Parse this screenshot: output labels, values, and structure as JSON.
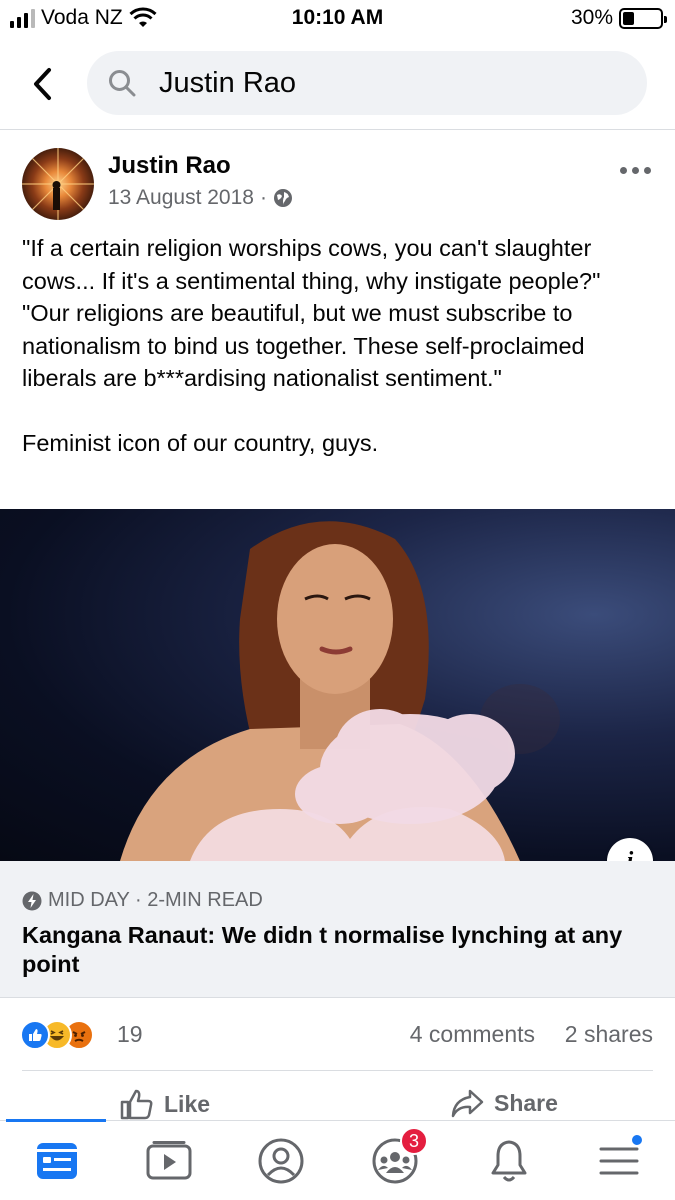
{
  "status_bar": {
    "carrier": "Voda NZ",
    "time": "10:10 AM",
    "battery_percent": "30%",
    "battery_level": 0.3,
    "signal_bars": 3
  },
  "search": {
    "value": "Justin Rao"
  },
  "post": {
    "author": "Justin Rao",
    "date": "13 August 2018",
    "meta_separator": "·",
    "privacy_icon": "globe-icon",
    "text": "\"If a certain religion worships cows, you can't slaughter cows... If it's a sentimental thing, why instigate people?\" \"Our religions are beautiful, but we must subscribe to nationalism to bind us together. These self-proclaimed liberals are b***ardising nationalist sentiment.\"\n\nFeminist icon of our country, guys."
  },
  "link_preview": {
    "source": "MID DAY · 2-MIN READ",
    "title": "Kangana Ranaut: We didn t normalise lynching at any point",
    "info_label": "i"
  },
  "reactions": {
    "icons": [
      "like-icon",
      "haha-icon",
      "angry-icon"
    ],
    "count": "19",
    "comments": "4 comments",
    "shares": "2 shares"
  },
  "actions": {
    "like_label": "Like",
    "share_label": "Share"
  },
  "bottom_nav": {
    "items": [
      "news-feed-icon",
      "watch-icon",
      "profile-icon",
      "groups-icon",
      "notifications-icon",
      "menu-icon"
    ],
    "groups_badge": "3"
  },
  "colors": {
    "accent": "#1877f2",
    "badge": "#e41e3f",
    "secondary_text": "#65676b",
    "surface": "#f0f2f5"
  }
}
